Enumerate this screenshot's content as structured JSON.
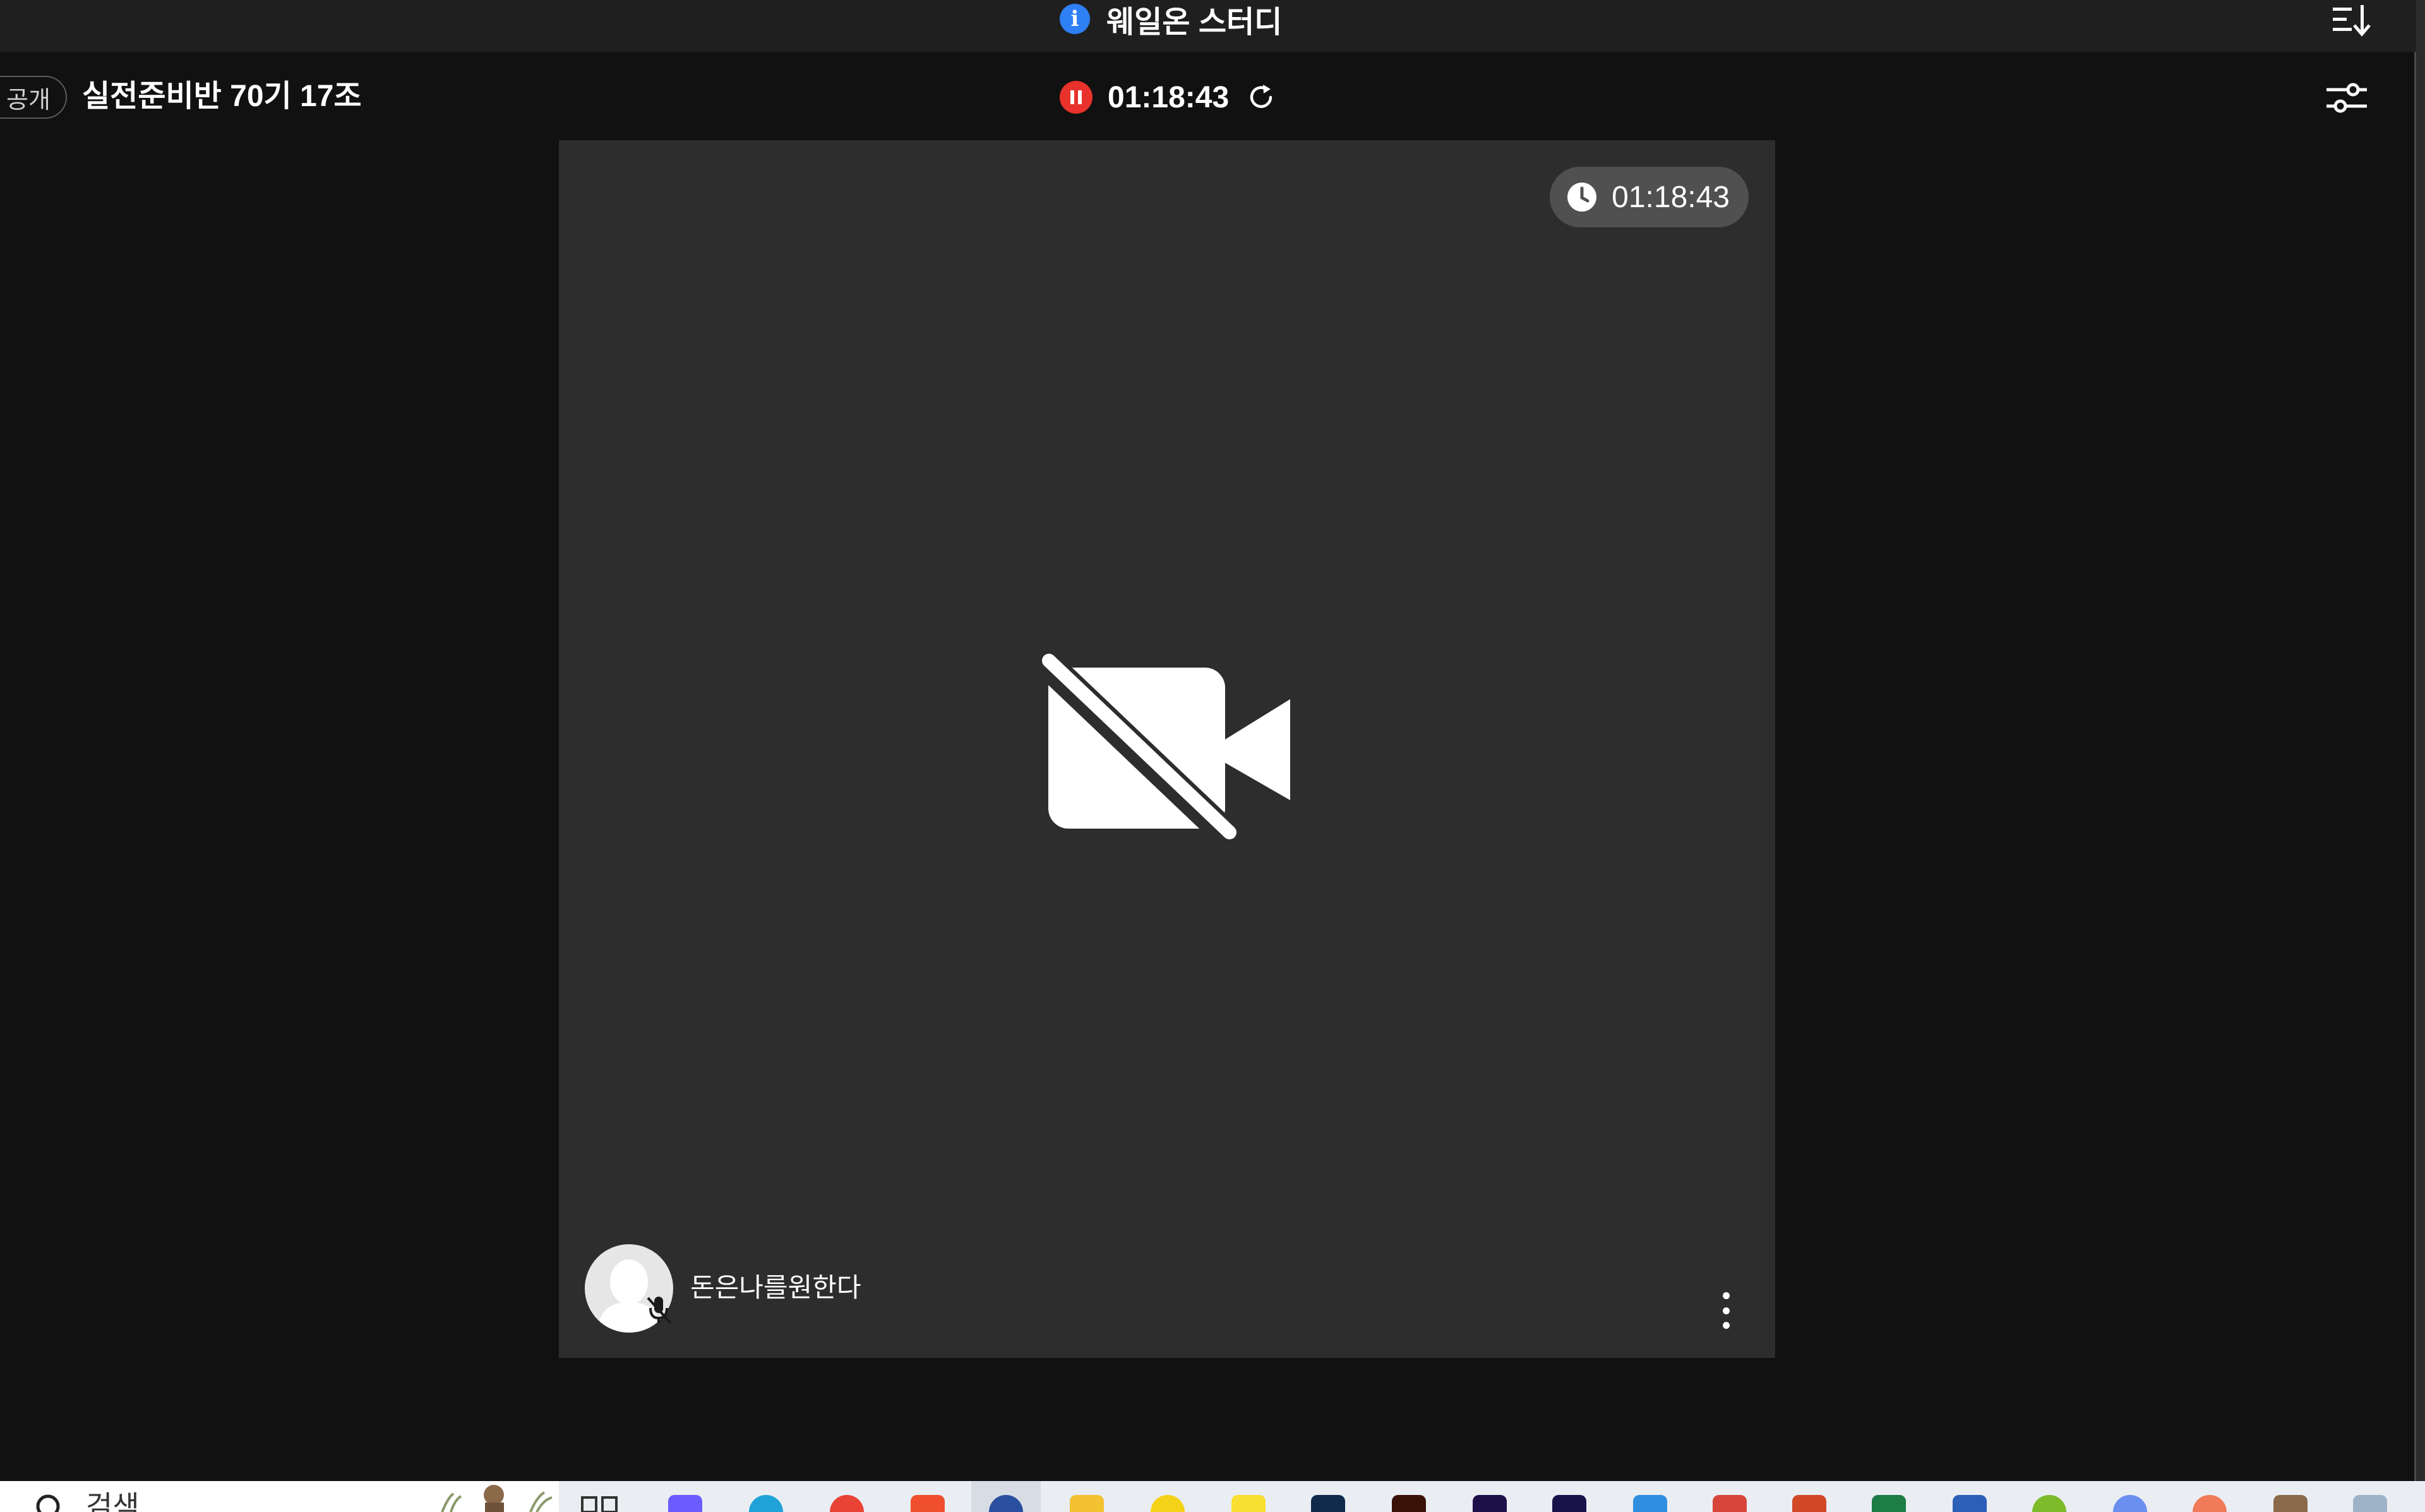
{
  "app": {
    "title": "웨일온 스터디"
  },
  "header": {
    "visibility_tag": "공개",
    "room_title": "실전준비반 70기 17조",
    "timer": "01:18:43"
  },
  "video": {
    "badge_timer": "01:18:43",
    "participant_name": "돈은나를원한다",
    "camera_state": "off",
    "mic_state": "muted"
  },
  "taskbar": {
    "search_placeholder": "검색"
  },
  "icons": {
    "info": "info-icon",
    "sort": "sort-icon",
    "pause": "pause-icon",
    "refresh": "refresh-icon",
    "settings": "sliders-icon",
    "clock": "clock-icon",
    "camera_off": "video-off-icon",
    "mic_off": "mic-off-icon",
    "more": "more-vertical-icon",
    "search": "search-icon"
  },
  "colors": {
    "title_bar": "#1f1f1f",
    "background": "#111111",
    "tile": "#2d2d2d",
    "badge": "#505050",
    "record": "#e8322b",
    "info": "#2f7ff5"
  }
}
